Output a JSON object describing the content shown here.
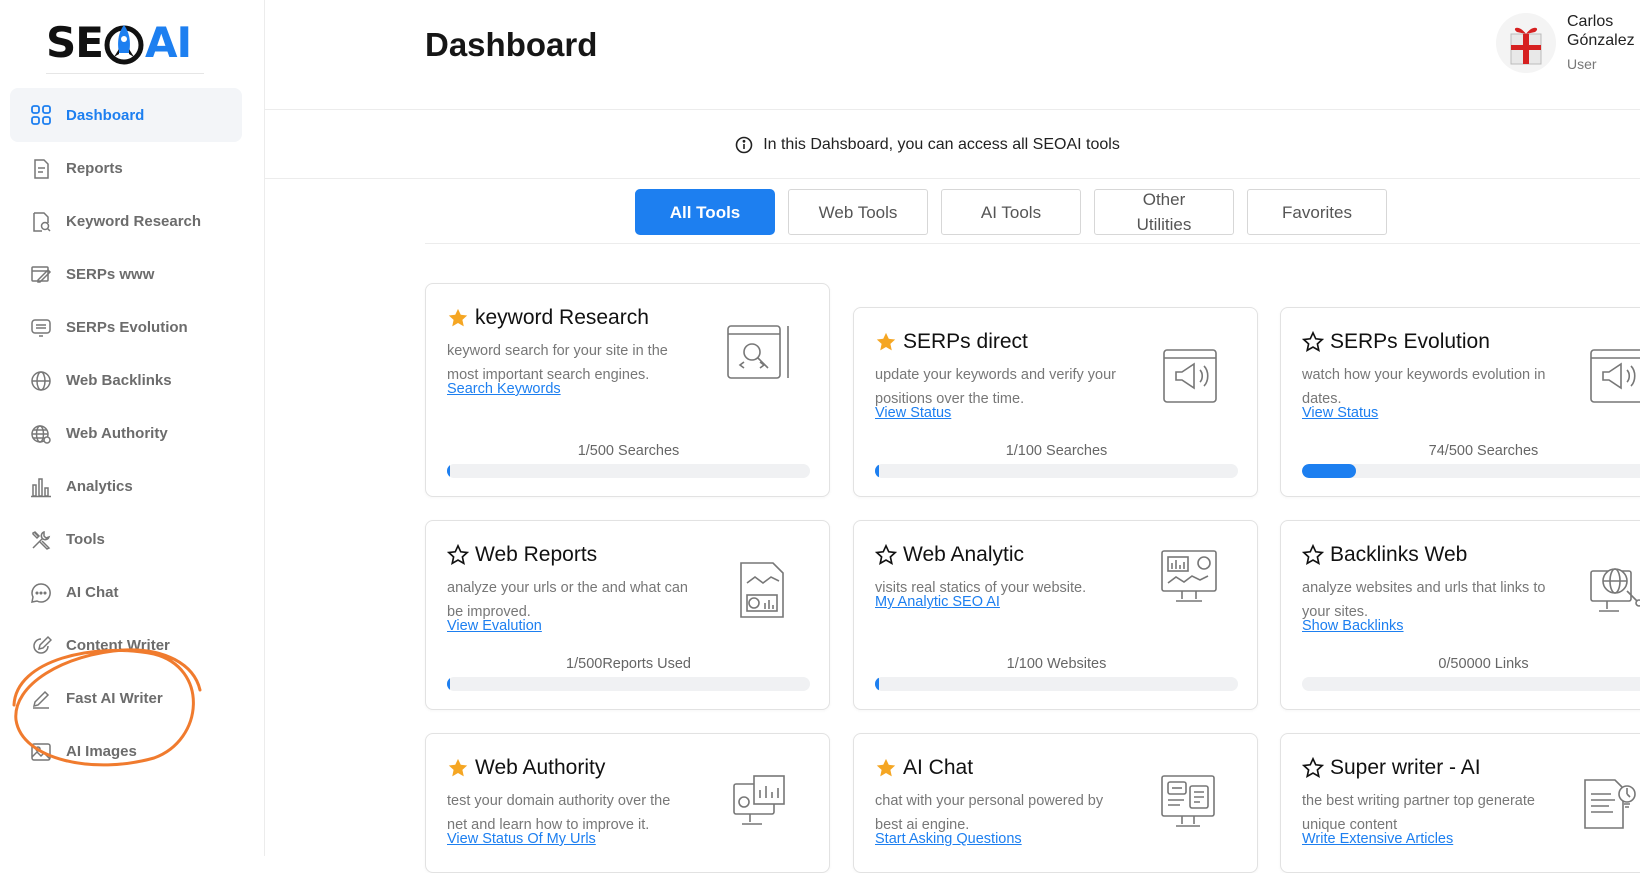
{
  "brand": {
    "logo_left": "SE",
    "logo_right": "AI"
  },
  "sidebar": {
    "items": [
      {
        "label": "Dashboard",
        "icon": "grid-icon",
        "active": true
      },
      {
        "label": "Reports",
        "icon": "document-icon"
      },
      {
        "label": "Keyword Research",
        "icon": "search-document-icon"
      },
      {
        "label": "SERPs www",
        "icon": "browser-pencil-icon"
      },
      {
        "label": "SERPs Evolution",
        "icon": "monitor-list-icon"
      },
      {
        "label": "Web Backlinks",
        "icon": "globe-icon"
      },
      {
        "label": "Web Authority",
        "icon": "globe-grid-icon"
      },
      {
        "label": "Analytics",
        "icon": "bar-chart-icon"
      },
      {
        "label": "Tools",
        "icon": "tools-icon"
      },
      {
        "label": "AI Chat",
        "icon": "chat-bubble-icon"
      },
      {
        "label": "Content Writer",
        "icon": "pencil-circle-icon"
      },
      {
        "label": "Fast AI Writer",
        "icon": "pen-icon"
      },
      {
        "label": "AI Images",
        "icon": "image-icon"
      }
    ]
  },
  "header": {
    "title": "Dashboard",
    "user": {
      "name": "Carlos Gónzalez",
      "role": "User"
    }
  },
  "info_banner": {
    "text": "In this Dahsboard, you can access all SEOAI tools"
  },
  "tabs": [
    {
      "label": "All Tools",
      "active": true
    },
    {
      "label": "Web Tools"
    },
    {
      "label": "AI Tools"
    },
    {
      "label": "Other Utilities"
    },
    {
      "label": "Favorites"
    }
  ],
  "cards": [
    {
      "title": "keyword Research",
      "favorite": true,
      "desc": "keyword search for your site in the most important search engines.",
      "link": "Search Keywords",
      "usage": "1/500 Searches",
      "progress": 0.002,
      "icon": "keyword-research-illustration"
    },
    {
      "title": "SERPs direct",
      "favorite": true,
      "desc": "update your keywords and verify your positions over the time.",
      "link": "View Status",
      "usage": "1/100 Searches",
      "progress": 0.01,
      "icon": "serps-megaphone-illustration"
    },
    {
      "title": "SERPs Evolution",
      "favorite": false,
      "desc": "watch how your keywords evolution in dates.",
      "link": "View Status",
      "usage": "74/500 Searches",
      "progress": 0.148,
      "icon": "serps-megaphone-illustration"
    },
    {
      "title": "Web Reports",
      "favorite": false,
      "desc": "analyze your urls or the and what can be improved.",
      "link": "View Evalution",
      "usage": "1/500Reports Used",
      "progress": 0.002,
      "icon": "report-chart-illustration"
    },
    {
      "title": "Web Analytic",
      "favorite": false,
      "desc": "visits real statics of your website.",
      "link": "My Analytic SEO AI",
      "usage": "1/100 Websites",
      "progress": 0.01,
      "icon": "analytics-monitor-illustration"
    },
    {
      "title": "Backlinks Web",
      "favorite": false,
      "desc": "analyze websites and urls that links to your sites.",
      "link": "Show Backlinks",
      "usage": "0/50000 Links",
      "progress": 0,
      "icon": "globe-network-illustration"
    },
    {
      "title": "Web Authority",
      "favorite": true,
      "desc": "test your domain authority over the net and learn how to improve it.",
      "link": "View Status Of My Urls",
      "usage": "",
      "progress": null,
      "icon": "authority-monitor-illustration"
    },
    {
      "title": "AI Chat",
      "favorite": true,
      "desc": "chat with your personal powered by best ai engine.",
      "link": "Start Asking Questions",
      "usage": "",
      "progress": null,
      "icon": "chat-monitor-illustration"
    },
    {
      "title": "Super writer - AI",
      "favorite": false,
      "desc": "the best writing partner top generate unique content",
      "link": "Write Extensive Articles",
      "usage": "",
      "progress": null,
      "icon": "writer-idea-illustration"
    }
  ],
  "colors": {
    "accent": "#1d7ff0",
    "star": "#f5a623",
    "highlight": "#f07b2e"
  }
}
